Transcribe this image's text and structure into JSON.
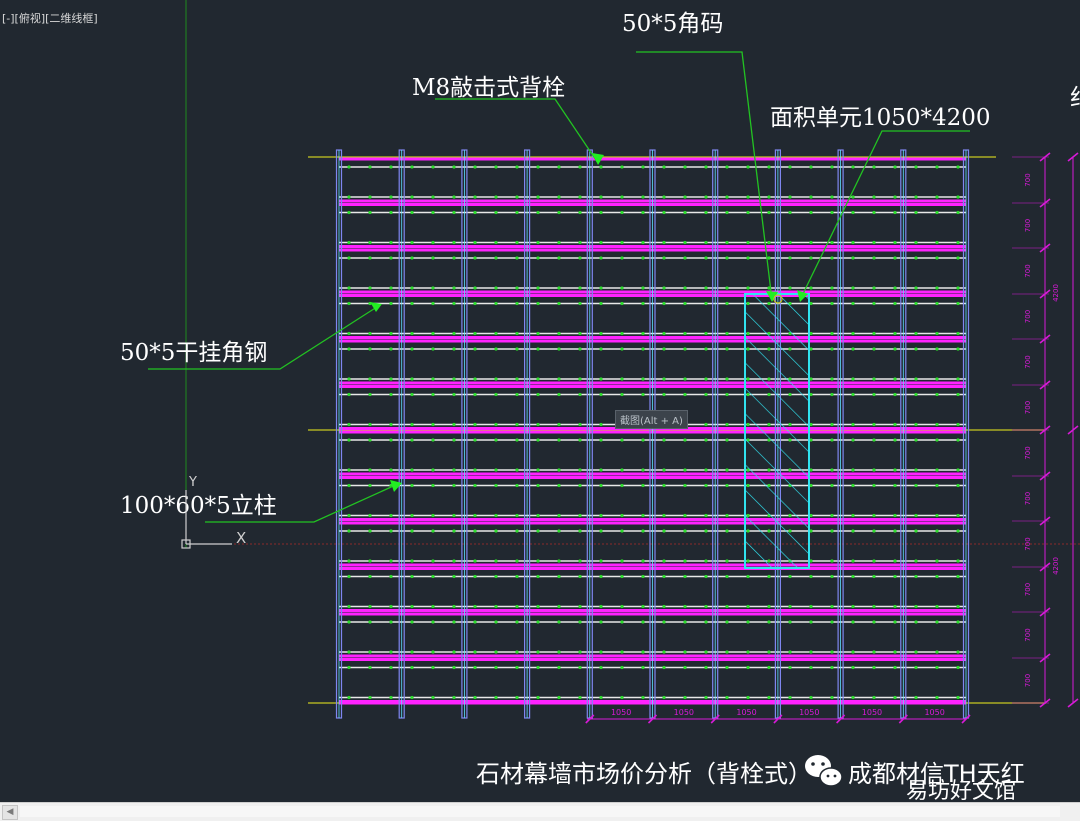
{
  "viewport": {
    "label": "[-][俯视][二维线框]",
    "background": "#212830"
  },
  "drawing": {
    "columns": 11,
    "rows": 12,
    "colors": {
      "mullion": "#7f86f0",
      "mullion_inner": "#5fe0ff",
      "beam_magenta": "#ff22ff",
      "angle_white": "#e8e8e8",
      "dot_green": "#2cdc2c",
      "leader_green": "#22c322",
      "dim_magenta": "#d81ad8",
      "guide_yellow": "#c8c820",
      "hatch_cyan": "#30e3f0",
      "axis_green": "#1e8a1e"
    },
    "dims": {
      "column_spacing": "1050",
      "row_spacing": "700",
      "total_height": "4200"
    }
  },
  "annotations": {
    "bolt": "M8敲击式背栓",
    "corner_code": "50*5角码",
    "area_unit": "面积单元1050*4200",
    "angle_steel": "50*5干挂角钢",
    "column": "100*60*5立柱"
  },
  "ucs": {
    "x_label": "X",
    "y_label": "Y"
  },
  "tooltip": "截图(Alt + A)",
  "caption": {
    "title": "石材幕墙市场价分析（背栓式）",
    "author": "成都材信TH天红",
    "icon": "wechat-icon"
  },
  "watermark": "易坊好文馆",
  "scrollbar": {
    "left_arrow": "◀"
  }
}
